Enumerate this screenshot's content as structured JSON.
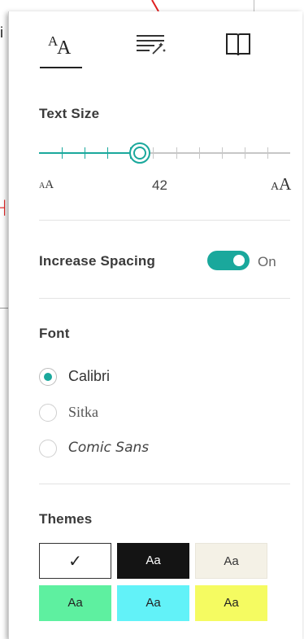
{
  "background": {
    "letter": "i"
  },
  "tabs": [
    {
      "name": "text-options",
      "icon": "text-size-icon",
      "selected": true
    },
    {
      "name": "grammar-options",
      "icon": "text-magic-icon",
      "selected": false
    },
    {
      "name": "reading-preferences",
      "icon": "book-icon",
      "selected": false
    }
  ],
  "text_size": {
    "title": "Text Size",
    "value": "42",
    "small_label_big": "A",
    "small_label_small": "A",
    "large_label_big": "A",
    "large_label_small": "A",
    "level": 0.4
  },
  "spacing": {
    "label": "Increase Spacing",
    "state": "On",
    "enabled": true
  },
  "font": {
    "title": "Font",
    "options": [
      {
        "label": "Calibri",
        "checked": true
      },
      {
        "label": "Sitka",
        "checked": false
      },
      {
        "label": "Comic Sans",
        "checked": false
      }
    ]
  },
  "themes": {
    "title": "Themes",
    "items": [
      {
        "label": "✓",
        "bg": "#ffffff"
      },
      {
        "label": "Aa",
        "bg": "#141414"
      },
      {
        "label": "Aa",
        "bg": "#f4f1e6"
      },
      {
        "label": "Aa",
        "bg": "#5ef0a0"
      },
      {
        "label": "Aa",
        "bg": "#62f2f8"
      },
      {
        "label": "Aa",
        "bg": "#f5fb61"
      }
    ]
  },
  "colors": {
    "accent": "#1aa89c"
  }
}
